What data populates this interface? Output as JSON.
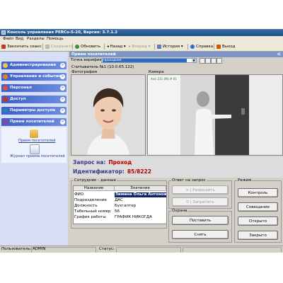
{
  "window": {
    "title": "Консоль управления PERCo-S-20, Версия: 3.7.1.2"
  },
  "menu": [
    "Файл",
    "Вид",
    "Разделы",
    "Помощь"
  ],
  "toolbar": {
    "end_session": "Закончить сеанс",
    "save": "Сохранить",
    "refresh": "Обновить",
    "back": "Назад",
    "forward": "Вперед",
    "history": "История",
    "help": "Справка",
    "exit": "Выход"
  },
  "sidebar": {
    "groups": [
      {
        "label": "Администрирование",
        "icon": "admin-icon"
      },
      {
        "label": "Управление и события",
        "icon": "events-icon"
      },
      {
        "label": "Персонал",
        "icon": "personnel-icon"
      },
      {
        "label": "Доступ",
        "icon": "access-icon"
      },
      {
        "label": "Параметры доступа",
        "icon": "access-params-icon"
      },
      {
        "label": "Прием посетителей",
        "icon": "visitors-icon"
      }
    ],
    "items": [
      {
        "label": "Прием посетителей",
        "icon": "visitor-reception-icon"
      },
      {
        "label": "Журнал приема посетителей",
        "icon": "visitor-journal-icon"
      }
    ]
  },
  "content": {
    "header": "Прием посетителей",
    "verification_label": "Точка верификации:",
    "verification_value": "проходная",
    "reader_label": "Считыватель №1 (10.0.65.122)",
    "photo_label": "Фотография",
    "camera_label": "Камера",
    "camera_overlay": "Axis 211 (IN) # 01"
  },
  "request": {
    "label": "Запрос на:",
    "value": "Проход",
    "id_label": "Идентификатор:",
    "id_value": "85/8222"
  },
  "employee": {
    "legend": "Сотрудник - данные",
    "col_name": "Название",
    "col_value": "Значение",
    "rows": [
      {
        "name": "ФИО",
        "value": "Зимина Ольга Антоновна"
      },
      {
        "name": "Подразделение",
        "value": "ДАС"
      },
      {
        "name": "Должность",
        "value": "Бухгалтер"
      },
      {
        "name": "Табельный номер",
        "value": "56"
      },
      {
        "name": "График работы",
        "value": "ГРАФИК НИКОГДА"
      }
    ]
  },
  "response": {
    "legend": "Ответ на запрос",
    "allow": "+ | Разрешить",
    "deny": "0 | Запретить"
  },
  "guard": {
    "legend": "Охрана",
    "set": "Поставить",
    "remove": "Снять"
  },
  "mode": {
    "legend": "Режим",
    "control": "Контроль",
    "unlock": "Совещание",
    "open": "Открыто",
    "closed": "Закрыто"
  },
  "status": {
    "user_label": "Пользователь:",
    "user_value": "ADMIN",
    "status_label": "Статус:"
  }
}
